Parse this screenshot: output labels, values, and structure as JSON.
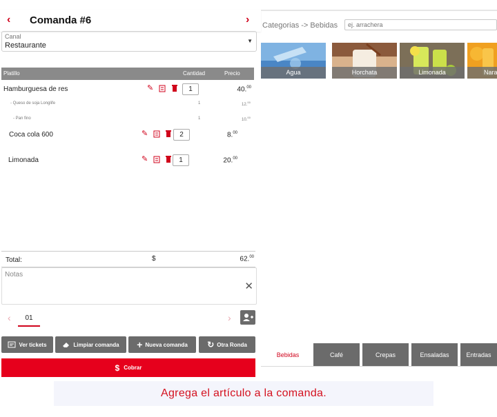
{
  "header": {
    "title": "Comanda #6",
    "prev_glyph": "‹",
    "next_glyph": "›"
  },
  "canal": {
    "label": "Canal",
    "value": "Restaurante"
  },
  "table": {
    "headers": [
      "Platillo",
      "Cantidad",
      "Precio"
    ],
    "items": [
      {
        "name": "Hamburguesa de res",
        "qty": "1",
        "price": "40.",
        "cents": "00",
        "modifiers": [
          {
            "name": "- Queso de soja Longlife",
            "qty": "1",
            "price": "12.",
            "cents": "00"
          },
          {
            "name": "- Pan fino",
            "qty": "1",
            "price": "10.",
            "cents": "00"
          }
        ]
      },
      {
        "name": "Coca cola 600",
        "qty": "2",
        "price": "8.",
        "cents": "00"
      },
      {
        "name": "Limonada",
        "qty": "1",
        "price": "20.",
        "cents": "00"
      }
    ]
  },
  "total": {
    "label": "Total:",
    "currency": "$",
    "amount": "62.",
    "cents": "00"
  },
  "notes": {
    "placeholder": "Notas"
  },
  "pager": {
    "page": "01"
  },
  "actions": {
    "ver_tickets": "Ver tickets",
    "limpiar": "Limpiar comanda",
    "nueva": "Nueva comanda",
    "otra_ronda": "Otra Ronda",
    "cobrar": "Cobrar",
    "cobrar_symbol": "$"
  },
  "catalog": {
    "breadcrumb": "Categorias -> Bebidas",
    "search_placeholder": "ej. arrachera",
    "products": [
      "Agua",
      "Horchata",
      "Limonada",
      "Nara"
    ],
    "tabs": [
      "Bebidas",
      "Café",
      "Crepas",
      "Ensaladas",
      "Entradas"
    ],
    "active_tab": "Bebidas"
  },
  "caption": "Agrega el artículo a la comanda.",
  "colors": {
    "accent": "#d0021b",
    "cobrar": "#e6001c",
    "button_gray": "#6b6b6b",
    "header_gray": "#8a8a8a"
  }
}
